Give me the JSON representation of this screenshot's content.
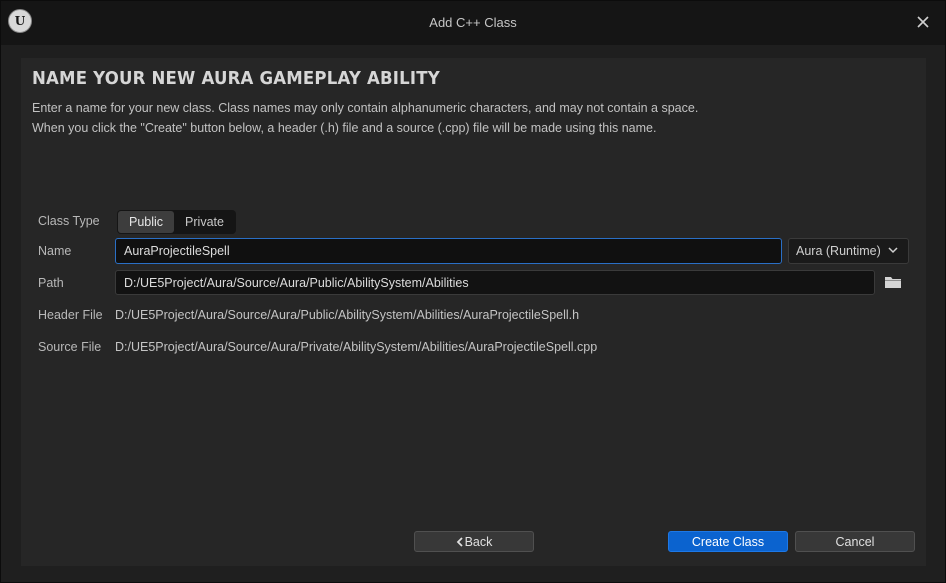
{
  "window": {
    "title": "Add C++ Class",
    "logo_text": "U"
  },
  "dialog": {
    "heading": "NAME YOUR NEW AURA GAMEPLAY ABILITY",
    "description_line1": "Enter a name for your new class. Class names may only contain alphanumeric characters, and may not contain a space.",
    "description_line2": "When you click the \"Create\" button below, a header (.h) file and a source (.cpp) file will be made using this name."
  },
  "form": {
    "class_type_label": "Class Type",
    "class_type_options": [
      "Public",
      "Private"
    ],
    "class_type_selected": "Public",
    "name_label": "Name",
    "name_value": "AuraProjectileSpell",
    "module_value": "Aura (Runtime)",
    "path_label": "Path",
    "path_value": "D:/UE5Project/Aura/Source/Aura/Public/AbilitySystem/Abilities",
    "header_label": "Header File",
    "header_value": "D:/UE5Project/Aura/Source/Aura/Public/AbilitySystem/Abilities/AuraProjectileSpell.h",
    "source_label": "Source File",
    "source_value": "D:/UE5Project/Aura/Source/Aura/Private/AbilitySystem/Abilities/AuraProjectileSpell.cpp"
  },
  "buttons": {
    "back": "Back",
    "create": "Create Class",
    "cancel": "Cancel"
  },
  "icons": {
    "close": "close-icon",
    "folder": "folder-icon",
    "back_chevron": "chevron-left-icon",
    "dropdown": "chevron-down-icon",
    "logo": "unreal-engine-logo-icon"
  },
  "colors": {
    "accent": "#0b63cf",
    "focus_border": "#2a6fc5",
    "panel_bg": "#262626",
    "window_bg": "#1f1f1f"
  }
}
